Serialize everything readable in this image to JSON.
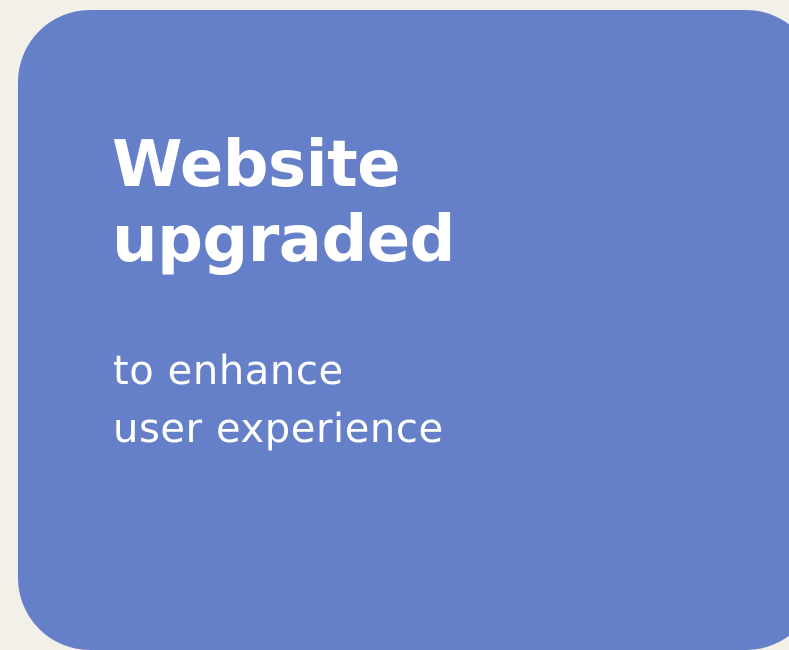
{
  "card": {
    "title_lines": [
      "Website",
      "upgraded"
    ],
    "subtitle_lines": [
      "to enhance",
      "user experience"
    ]
  },
  "colors": {
    "background": "#f3f0ea",
    "card": "#6580c8",
    "text": "#ffffff"
  }
}
